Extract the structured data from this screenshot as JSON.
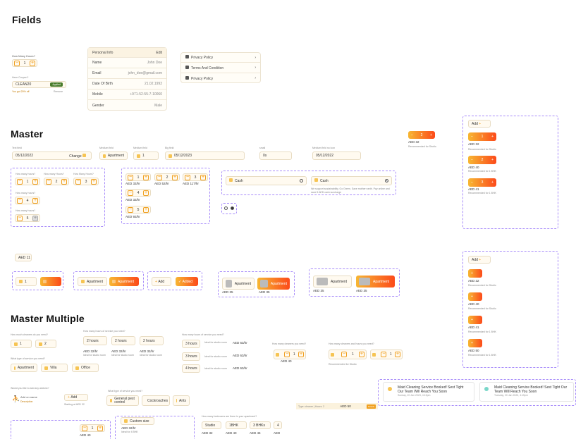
{
  "sections": {
    "fields": "Fields",
    "master": "Master",
    "master_multiple": "Master Multiple"
  },
  "fields": {
    "hours_label": "How Many Hours?",
    "hours_value": "1",
    "coupon_label": "Have Coupon?",
    "coupon_value": "CLEAN20",
    "coupon_badge": "Applied",
    "coupon_note": "You got 20% off",
    "coupon_remove": "Remove",
    "personal": {
      "title": "Personal Info",
      "edit": "Edit",
      "rows": [
        {
          "k": "Name",
          "v": "John Doe"
        },
        {
          "k": "Email",
          "v": "john_doe@gmail.com"
        },
        {
          "k": "Date Of Birth",
          "v": "21.02.1992"
        },
        {
          "k": "Mobile",
          "v": "+971-52-55-7-10060"
        },
        {
          "k": "Gender",
          "v": "Male"
        }
      ]
    },
    "links": [
      "Privacy Policy",
      "Terms And Condition",
      "Privacy Policy"
    ]
  },
  "master": {
    "text_field_label": "Text field",
    "text_field_value": "05/12/2022",
    "text_field_action": "Change",
    "medium_field_label": "Medium field",
    "medium_field_value": "Apartment",
    "medium_field2_label": "Medium field",
    "medium_field2_value": "1",
    "big_field_label": "Big field",
    "big_field_value": "05/12/2023",
    "small_label": "small",
    "small_value": "0s",
    "medium_field_no_icon_label": "Medium field no icon",
    "medium_field_no_icon_value": "05/12/2022",
    "q_cleaners": "How many hours?",
    "q_hours": "How many Hours?",
    "q_hours2": "How Many Hours?",
    "v1": "1",
    "v2": "2",
    "v3": "3",
    "v4": "4",
    "v5": "5",
    "price_1": "AED 32/hr",
    "price_2": "AED 52/hr",
    "price_3": "AED 117/hr",
    "price_4": "AED 32/hr",
    "price_5": "AED 92/hr",
    "pay_cash1": "Cash",
    "pay_cash2": "Cash",
    "pay_note": "We support sustainability. Go Green, Save mother earth. Pay online and save 5 AED cash surcharge",
    "top_price": "AED 32",
    "top_reco": "Recommended for Studio",
    "aed_tag": "AED 11",
    "opt_apartment": "Apartment",
    "opt_add": "Add",
    "opt_added": "Added",
    "aed_35": "AED 35",
    "right_add": "Add",
    "right_items": [
      {
        "price": "AED 32",
        "reco": "Recommended for Studio"
      },
      {
        "price": "AED 40",
        "reco": "Recommended for 1 BHK"
      },
      {
        "price": "AED 41",
        "reco": "Recommended for 1 BHK"
      }
    ],
    "right2_items": [
      {
        "price": "AED 32",
        "reco": "Recommended for Studio"
      },
      {
        "price": "AED 40",
        "reco": "Recommended for Studio"
      },
      {
        "price": "AED 41",
        "reco": "Recommended for 1 BHK"
      },
      {
        "price": "AED 50",
        "reco": "Recommended for 1 BHK"
      }
    ]
  },
  "multiple": {
    "q_cleaners": "How much cleaners do you need?",
    "q_hours": "How many hours of service you need?",
    "q_hours2": "How many hours of service you need?",
    "q_cleaners2": "How many cleaners you need?",
    "q_cleaners_hours": "How many cleaners and hours you need?",
    "q_type": "What type of service you need?",
    "q_type2": "What type of service you need?",
    "q_addons": "Would you like to add any addons?",
    "q_bedrooms": "How many bedrooms are there in your apartment?",
    "c1": "1",
    "c2": "2",
    "h2": "2 hours",
    "h2b": "2 hours",
    "h2c": "2 hours",
    "h3": "3 hours",
    "h3b": "3 hours",
    "h4": "4 hours",
    "p1": "AED 32/hr",
    "p2": "AED 32/hr",
    "p3": "AED 32/hr",
    "p_ideal": "Ideal for studio room",
    "aed63": "AED 63/hr",
    "apartment": "Apartment",
    "villa": "Villa",
    "office": "Office",
    "general": "General pest control",
    "cockroaches": "Cockroaches",
    "ants": "Ants",
    "addon_name": "Add on name",
    "addon_desc": "Description",
    "addon_add": "Add",
    "addon_price": "Starting at AED 32",
    "custom_size": "Custom size",
    "custom_price": "AED 32/hr",
    "custom_ideal": "Ideal for 4 BHK",
    "bed_studio": "Studio",
    "bed_1": "1BHK",
    "bed_3": "3 BHKs",
    "bed_4": "4",
    "bed_p1": "AED 32",
    "bed_p2": "AED 40",
    "bed_p3": "AED 45",
    "bed_p4": "AED",
    "rec_studio": "Recommended for Studio",
    "aed_40": "AED 40",
    "bar_text": "Type: cleaner | Hours: 2",
    "bar_price": "AED 50",
    "bar_btn": "Details",
    "notif1": "Maid Cleaning Service Booked! Sest Tight Our Team Will Reach You Soon",
    "notif1_time": "Sunday, 20 Jan 2023, 4:15pm",
    "notif2": "Maid Cleaning Service Booked! Sest Tight Our Team Will Reach You Soon",
    "notif2_time": "Tuesday, 20 Jan 2023, 4:15pm"
  },
  "colors": {
    "accent": "#f0a020",
    "gradient_start": "#f7b733",
    "gradient_end": "#fc4a1a",
    "dashed": "#a78bfa"
  }
}
